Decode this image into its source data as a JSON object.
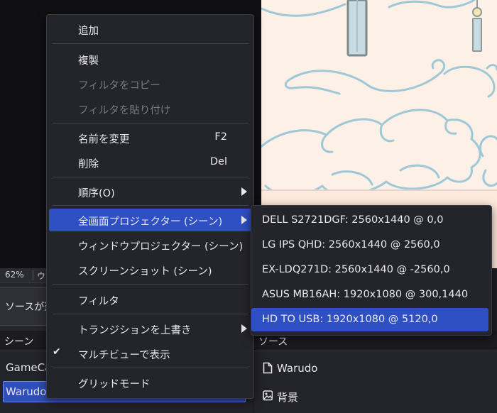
{
  "status_bar": {
    "zoom": "62%",
    "truncated_label": "ウ"
  },
  "properties_bar": {
    "no_source_text": "ソースが選択されていません"
  },
  "scenes": {
    "header": "シーン",
    "items": [
      {
        "label": "GameCapture"
      },
      {
        "label": "Warudo Capture"
      }
    ]
  },
  "sources": {
    "header": "ソース",
    "items": [
      {
        "label": "Warudo",
        "icon": "file-icon"
      },
      {
        "label": "背景",
        "icon": "image-icon"
      }
    ]
  },
  "context_menu": {
    "items": [
      {
        "label": "追加"
      },
      {
        "label": "複製"
      },
      {
        "label": "フィルタをコピー",
        "disabled": true
      },
      {
        "label": "フィルタを貼り付け",
        "disabled": true
      },
      {
        "label": "名前を変更",
        "shortcut": "F2"
      },
      {
        "label": "削除",
        "shortcut": "Del"
      },
      {
        "label": "順序(O)",
        "submenu": true
      },
      {
        "label": "全画面プロジェクター (シーン)",
        "submenu": true,
        "active": true
      },
      {
        "label": "ウィンドウプロジェクター (シーン)"
      },
      {
        "label": "スクリーンショット (シーン)"
      },
      {
        "label": "フィルタ"
      },
      {
        "label": "トランジションを上書き",
        "submenu": true
      },
      {
        "label": "マルチビューで表示",
        "checked": true,
        "check_glyph": "✔"
      },
      {
        "label": "グリッドモード"
      }
    ]
  },
  "projector_submenu": {
    "items": [
      {
        "label": "DELL S2721DGF: 2560x1440 @ 0,0"
      },
      {
        "label": "LG IPS QHD: 2560x1440 @ 2560,0"
      },
      {
        "label": "EX-LDQ271D: 2560x1440 @ -2560,0"
      },
      {
        "label": "ASUS MB16AH: 1920x1080 @ 300,1440"
      },
      {
        "label": "HD TO USB: 1920x1080 @ 5120,0",
        "active": true
      }
    ]
  },
  "colors": {
    "accent": "#2f50c2",
    "menu_bg": "#24242b",
    "canvas_bg": "#fdf0e6",
    "cloud_stroke": "#9ec8d8"
  }
}
